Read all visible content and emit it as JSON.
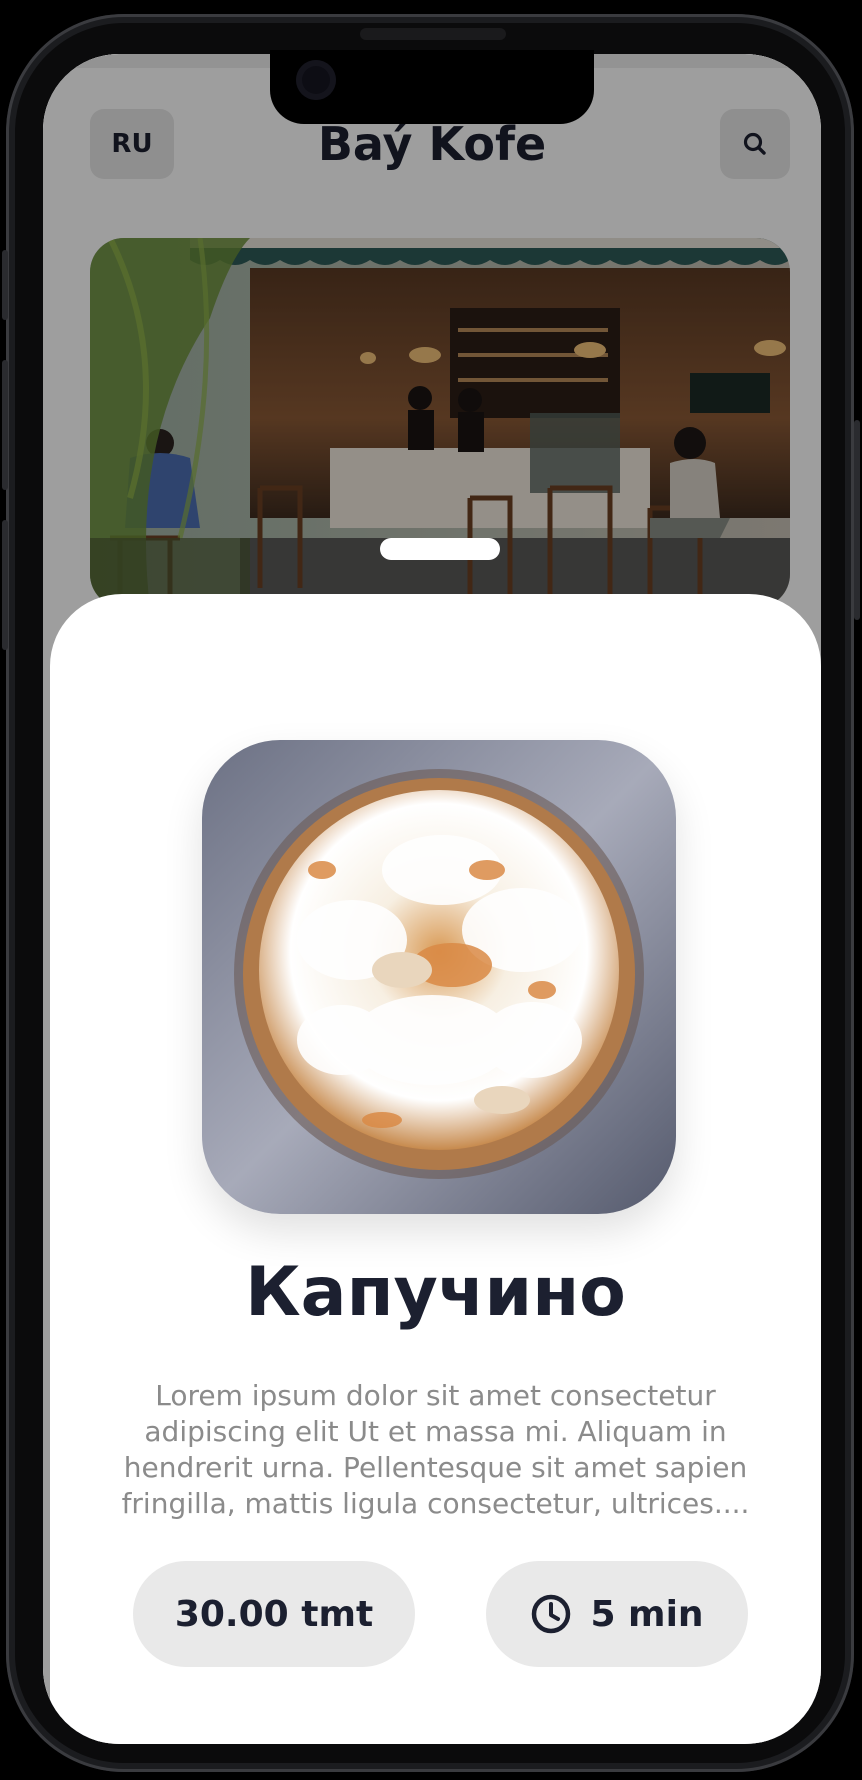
{
  "header": {
    "language_label": "RU",
    "title": "Baý Kofe",
    "search_icon": "search-icon"
  },
  "hero": {
    "image": "cafe-storefront-photo"
  },
  "product": {
    "image": "whipped-cream-coffee-photo",
    "name": "Капучино",
    "description": "Lorem ipsum dolor sit amet consectetur adipiscing elit Ut et massa mi. Aliquam in hendrerit urna. Pellentesque sit amet sapien fringilla, mattis ligula consectetur, ultrices....",
    "price_label": "30.00 tmt",
    "time_label": "5 min",
    "time_icon": "clock-icon"
  },
  "colors": {
    "text_dark": "#1c2030",
    "text_muted": "#8b8b8b",
    "pill_bg": "#e9e9e9",
    "button_bg": "#e7e7e7"
  }
}
